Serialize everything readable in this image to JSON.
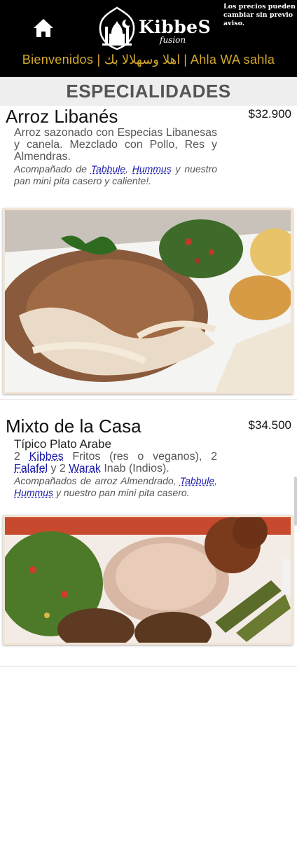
{
  "header": {
    "logo_name": "KibbeS",
    "logo_sub": "fusion",
    "price_note": "Los precios pueden cambiar sin previo aviso.",
    "welcome": "Bienvenidos | اهلا وسهلالا بك | Ahla WA sahla",
    "home_icon": "home-icon"
  },
  "section": {
    "title": "ESPECIALIDADES"
  },
  "dishes": [
    {
      "name": "Arroz Libanés",
      "price": "$32.900",
      "desc": "Arroz sazonado con Especias Libanesas y canela. Mezclado con Pollo, Res y Almendras.",
      "sub_a": "Acompañado de ",
      "link_1": "Tabbule",
      "sub_b": ", ",
      "link_2": "Hummus",
      "sub_c": " y nuestro pan mini pita casero y caliente!."
    },
    {
      "name": "Mixto de la Casa",
      "price": "$34.500",
      "tagline": "Típico Plato Arabe",
      "desc_a": "2 ",
      "link_kibbes": "Kibbes",
      "desc_b": " Fritos (res o veganos), 2 ",
      "link_falafel": "Falafel",
      "desc_c": " y 2 ",
      "link_warak": "Warak",
      "desc_d": " Inab (Indios).",
      "sub_a": "Acompañados de arroz Almendrado, ",
      "link_1": "Tabbule",
      "sub_b": ", ",
      "link_2": "Hummus",
      "sub_c": " y nuestro pan mini pita casero."
    }
  ],
  "colors": {
    "header_bg": "#000000",
    "accent_gold": "#d4a92c",
    "link_blue": "#1a1aa8",
    "section_bg": "#eeeeee"
  }
}
